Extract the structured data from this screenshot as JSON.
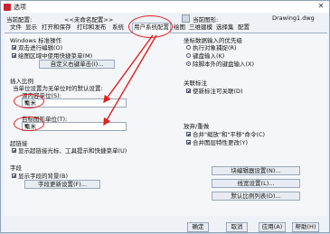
{
  "window": {
    "title": "选项",
    "close_glyph": "✕"
  },
  "profile": {
    "current_profile_label": "当前配置:",
    "current_profile_value": "<<未命名配置>>",
    "current_drawing_label": "当前图形:",
    "current_drawing_value": "Drawing1.dwg"
  },
  "tabs": [
    {
      "label": "文件"
    },
    {
      "label": "显示"
    },
    {
      "label": "打开和保存"
    },
    {
      "label": "打印和发布"
    },
    {
      "label": "系统"
    },
    {
      "label": "用户系统配置"
    },
    {
      "label": "绘图"
    },
    {
      "label": "三维建模"
    },
    {
      "label": "选择集"
    },
    {
      "label": "配置"
    }
  ],
  "windows_std": {
    "title": "Windows 标准操作",
    "double_click_edit": "双击进行编辑(O)",
    "shortcut_menu": "绘图区域中使用快捷菜单(M)",
    "right_click_btn": "自定义右键单击(I)..."
  },
  "insert_scale": {
    "title": "插入比例",
    "desc": "当单位设置为无单位时的默认设置:",
    "source_label": "源内容单位(S):",
    "source_value": "毫米",
    "target_label": "目标图形单位(T):",
    "target_value": "毫米"
  },
  "hyperlink": {
    "title": "超链接",
    "show_cursor": "显示超链接光标、工具提示和快捷菜单(U)"
  },
  "fields": {
    "title": "字段",
    "show_bg": "显示字段的背景(B)",
    "settings_btn": "字段更新设置(F)..."
  },
  "priority": {
    "title": "坐标数据输入的优先级",
    "opt1": "执行对象捕捉(R)",
    "opt2": "键盘输入(K)",
    "opt3": "除脚本外的键盘输入(X)",
    "selected": "opt3"
  },
  "assoc": {
    "title": "关联标注",
    "make_assoc": "使新标注可关联(D)"
  },
  "undo": {
    "title": "放弃/重做",
    "merge_zoom": "合并\"缩放\"和\"平移\"命令(C)",
    "merge_layer": "合并图层特性更改(Y)"
  },
  "right_buttons": {
    "block_editor": "块编辑器设置(N)...",
    "lineweight": "线宽设置(L)...",
    "scale_list": "默认比例列表(D)..."
  },
  "bottom": {
    "ok": "确定",
    "cancel": "取消",
    "apply": "应用(A)",
    "help": "帮助(H)"
  },
  "colors": {
    "annotation": "#e02020"
  }
}
